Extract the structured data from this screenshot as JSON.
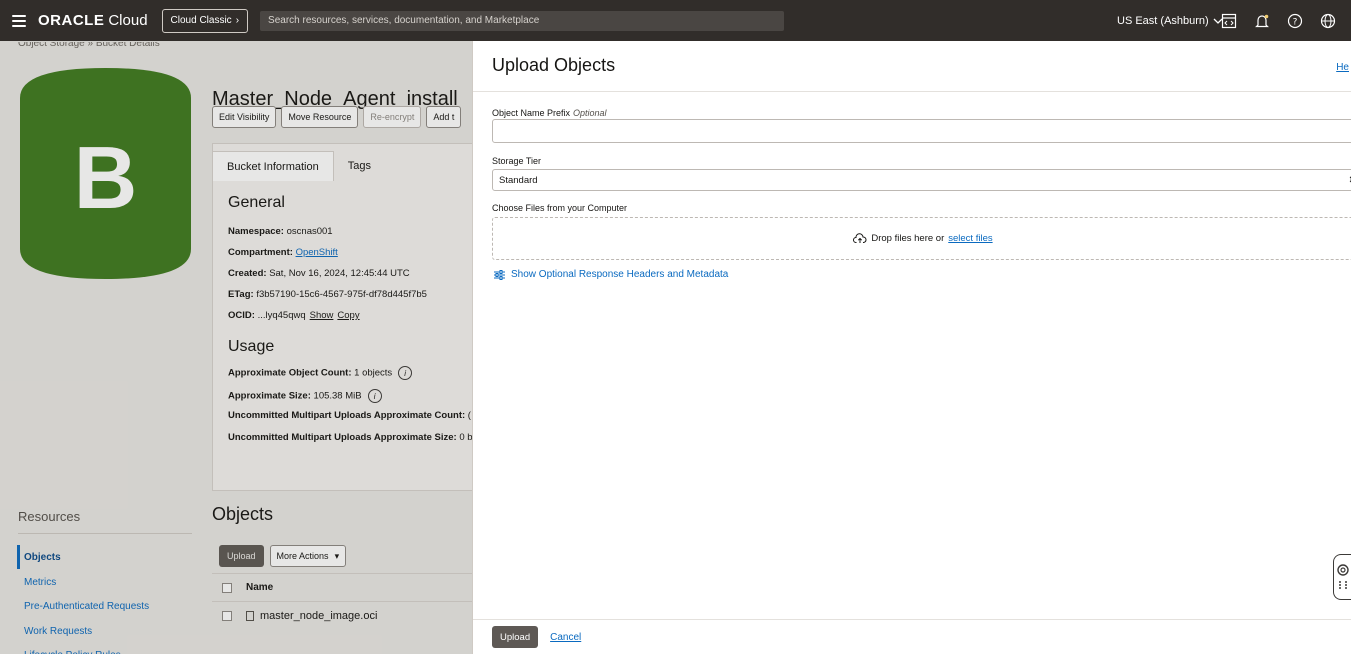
{
  "topbar": {
    "brand_oracle": "ORACLE",
    "brand_cloud": "Cloud",
    "classic_label": "Cloud Classic",
    "search_placeholder": "Search resources, services, documentation, and Marketplace",
    "region": "US East (Ashburn)"
  },
  "background_page": {
    "breadcrumb": "Object Storage » Bucket Details",
    "bucket_letter": "B",
    "bucket_name": "Master_Node_Agent_install",
    "actions": [
      "Edit Visibility",
      "Move Resource",
      "Re-encrypt",
      "Add t"
    ],
    "tabs": [
      "Bucket Information",
      "Tags"
    ],
    "general_heading": "General",
    "namespace_label": "Namespace:",
    "namespace_value": "oscnas001",
    "compartment_label": "Compartment:",
    "compartment_value": "OpenShift",
    "created_label": "Created:",
    "created_value": "Sat, Nov 16, 2024, 12:45:44 UTC",
    "etag_label": "ETag:",
    "etag_value": "f3b57190-15c6-4567-975f-df78d445f7b5",
    "ocid_label": "OCID:",
    "ocid_value": "...lyq45qwq",
    "ocid_show": "Show",
    "ocid_copy": "Copy",
    "usage_heading": "Usage",
    "obj_count_label": "Approximate Object Count:",
    "obj_count_value": "1 objects",
    "size_label": "Approximate Size:",
    "size_value": "105.38 MiB",
    "multipart_count_label": "Uncommitted Multipart Uploads Approximate Count:",
    "multipart_count_value": "(",
    "multipart_size_label": "Uncommitted Multipart Uploads Approximate Size:",
    "multipart_size_value": "0 b",
    "resources_heading": "Resources",
    "resources": [
      "Objects",
      "Metrics",
      "Pre-Authenticated Requests",
      "Work Requests",
      "Lifecycle Policy Rules"
    ],
    "objects_heading": "Objects",
    "upload_button": "Upload",
    "more_actions": "More Actions",
    "table_header_name": "Name",
    "object_file": "master_node_image.oci"
  },
  "panel": {
    "title": "Upload Objects",
    "help": "He",
    "prefix_label": "Object Name Prefix",
    "prefix_optional": "Optional",
    "prefix_value": "",
    "tier_label": "Storage Tier",
    "tier_value": "Standard",
    "files_label": "Choose Files from your Computer",
    "drop_text": "Drop files here or",
    "select_files": "select files",
    "optional_headers": "Show Optional Response Headers and Metadata",
    "upload_button": "Upload",
    "cancel": "Cancel"
  },
  "colors": {
    "topbar": "#312d2a",
    "bucket_green": "#3f7a1f",
    "link": "#0a6ac0",
    "button_dark": "#5e5955"
  }
}
